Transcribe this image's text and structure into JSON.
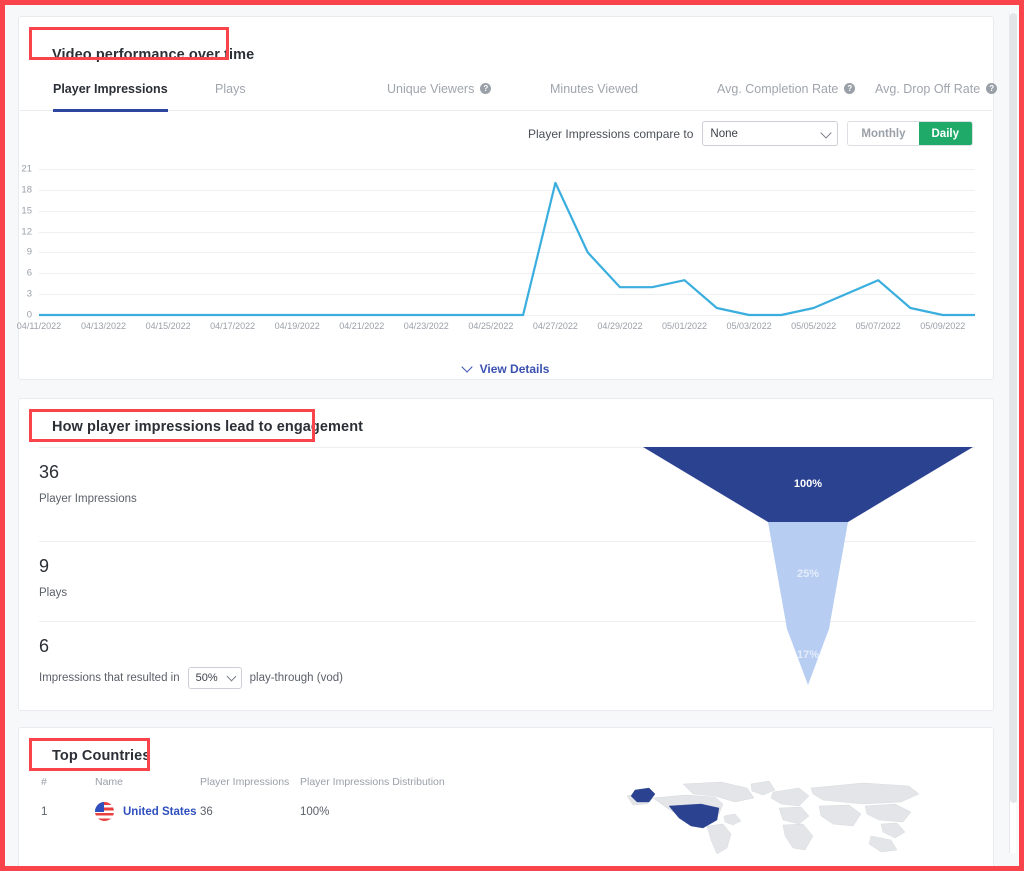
{
  "sections": {
    "performance": {
      "title": "Video performance over time"
    },
    "funnel": {
      "title": "How player impressions lead to engagement"
    },
    "countries": {
      "title": "Top Countries"
    }
  },
  "tabs": [
    {
      "label": "Player Impressions",
      "active": true,
      "help": false
    },
    {
      "label": "Plays",
      "active": false,
      "help": false
    },
    {
      "label": "Unique Viewers",
      "active": false,
      "help": true
    },
    {
      "label": "Minutes Viewed",
      "active": false,
      "help": false
    },
    {
      "label": "Avg. Completion Rate",
      "active": false,
      "help": true
    },
    {
      "label": "Avg. Drop Off Rate",
      "active": false,
      "help": true
    }
  ],
  "controls": {
    "compare_label": "Player Impressions compare to",
    "compare_value": "None",
    "compare_options": [
      "None"
    ],
    "granularity": [
      {
        "label": "Monthly",
        "selected": false
      },
      {
        "label": "Daily",
        "selected": true
      }
    ]
  },
  "view_details": {
    "label": "View Details",
    "icon": "chevron-down-icon"
  },
  "chart_data": {
    "type": "line",
    "title": "Video performance over time",
    "xlabel": "",
    "ylabel": "",
    "ylim": [
      0,
      21
    ],
    "yticks": [
      0,
      3,
      6,
      9,
      12,
      15,
      18,
      21
    ],
    "grid": true,
    "legend": false,
    "line_color": "#3aaede",
    "xtick_labels": [
      "04/11/2022",
      "04/13/2022",
      "04/15/2022",
      "04/17/2022",
      "04/19/2022",
      "04/21/2022",
      "04/23/2022",
      "04/25/2022",
      "04/27/2022",
      "04/29/2022",
      "05/01/2022",
      "05/03/2022",
      "05/05/2022",
      "05/07/2022",
      "05/09/2022"
    ],
    "x": [
      "04/11/2022",
      "04/12/2022",
      "04/13/2022",
      "04/14/2022",
      "04/15/2022",
      "04/16/2022",
      "04/17/2022",
      "04/18/2022",
      "04/19/2022",
      "04/20/2022",
      "04/21/2022",
      "04/22/2022",
      "04/23/2022",
      "04/24/2022",
      "04/25/2022",
      "04/26/2022",
      "04/27/2022",
      "04/28/2022",
      "04/29/2022",
      "04/30/2022",
      "05/01/2022",
      "05/02/2022",
      "05/03/2022",
      "05/04/2022",
      "05/05/2022",
      "05/06/2022",
      "05/07/2022",
      "05/08/2022",
      "05/09/2022",
      "05/10/2022"
    ],
    "series": [
      {
        "name": "Player Impressions",
        "values": [
          0,
          0,
          0,
          0,
          0,
          0,
          0,
          0,
          0,
          0,
          0,
          0,
          0,
          0,
          0,
          0,
          19,
          9,
          4,
          4,
          5,
          1,
          0,
          0,
          1,
          3,
          5,
          1,
          0,
          0
        ]
      }
    ]
  },
  "funnel": {
    "metrics": [
      {
        "value": "36",
        "label": "Player Impressions"
      },
      {
        "value": "9",
        "label": "Plays"
      },
      {
        "value": "6",
        "label_before": "Impressions that resulted in",
        "select_value": "50%",
        "select_options": [
          "50%"
        ],
        "label_after": "play-through (vod)"
      }
    ],
    "stages": [
      {
        "pct_label": "100%",
        "pct": 100,
        "color": "#2b4291"
      },
      {
        "pct_label": "25%",
        "pct": 25,
        "color": "#b7cdf2"
      },
      {
        "pct_label": "17%",
        "pct": 17,
        "color": "#b7cdf2"
      }
    ]
  },
  "countries": {
    "columns": [
      "#",
      "Name",
      "Player Impressions",
      "Player Impressions Distribution"
    ],
    "rows": [
      {
        "index": "1",
        "flag": "us-flag-icon",
        "name": "United States",
        "impressions": "36",
        "distribution_pct": "100%",
        "distribution_value": 100
      }
    ],
    "map": {
      "highlight_color": "#2b4291",
      "base_color": "#e3e5e8",
      "highlighted": [
        "United States"
      ]
    }
  }
}
